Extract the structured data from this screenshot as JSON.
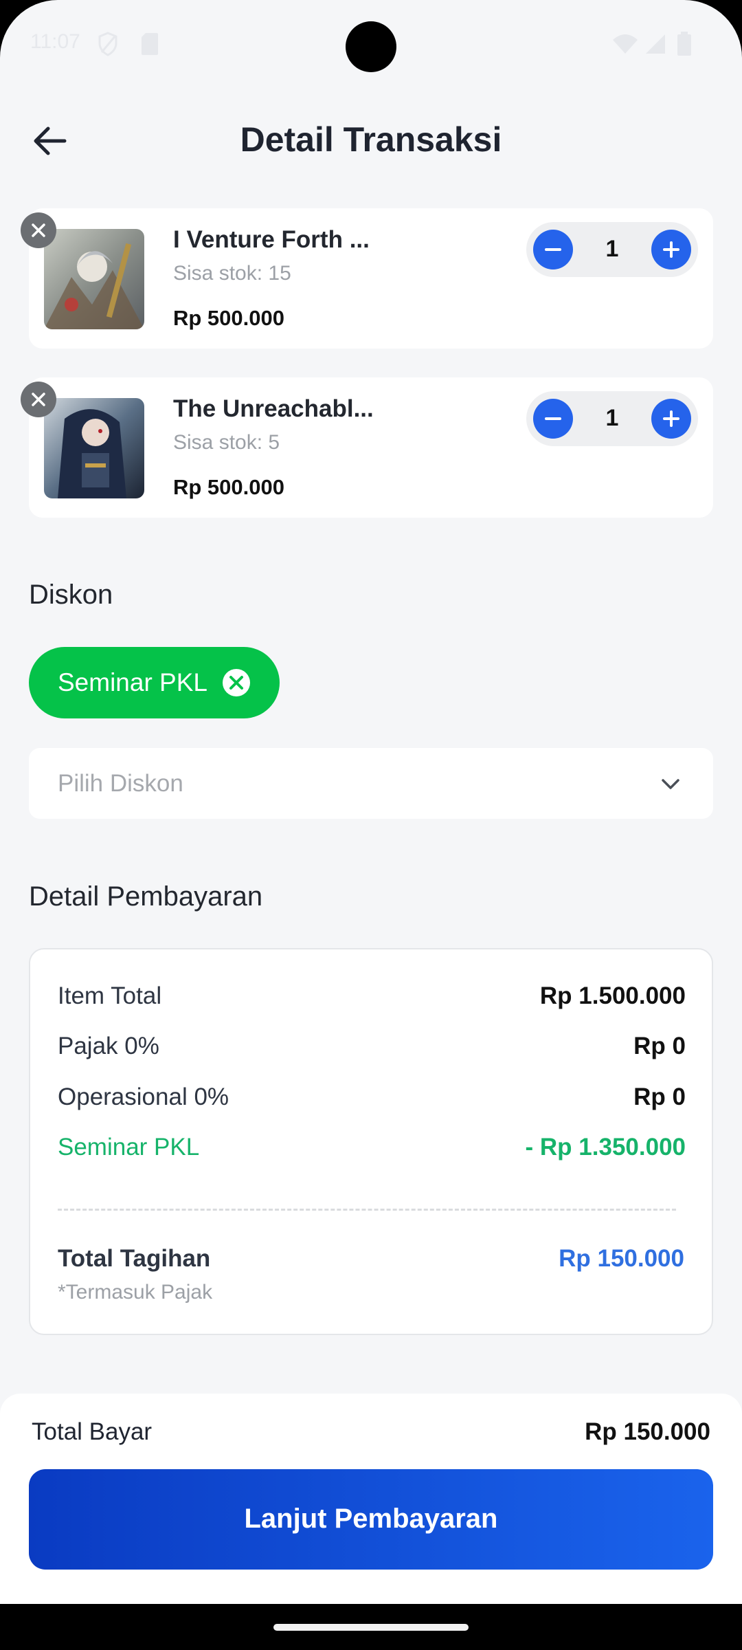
{
  "status_bar": {
    "time": "11:07"
  },
  "header": {
    "title": "Detail Transaksi"
  },
  "cart": {
    "items": [
      {
        "name": "I Venture Forth ...",
        "stock": "Sisa stok: 15",
        "price": "Rp 500.000",
        "qty": "1"
      },
      {
        "name": "The Unreachabl...",
        "stock": "Sisa stok: 5",
        "price": "Rp 500.000",
        "qty": "1"
      }
    ]
  },
  "discount": {
    "section_title": "Diskon",
    "applied_chip": "Seminar PKL",
    "select_placeholder": "Pilih Diskon"
  },
  "payment": {
    "section_title": "Detail Pembayaran",
    "rows": [
      {
        "label": "Item Total",
        "value": "Rp 1.500.000"
      },
      {
        "label": "Pajak 0%",
        "value": "Rp 0"
      },
      {
        "label": "Operasional 0%",
        "value": "Rp 0"
      },
      {
        "label": "Seminar PKL",
        "value": "- Rp 1.350.000"
      }
    ],
    "total_label": "Total Tagihan",
    "total_value": "Rp 150.000",
    "tax_note": "*Termasuk Pajak"
  },
  "bottom": {
    "label": "Total Bayar",
    "value": "Rp 150.000",
    "cta": "Lanjut Pembayaran"
  },
  "colors": {
    "primary": "#2563eb",
    "success": "#05c249",
    "discount_text": "#16b36a",
    "total_blue": "#2f6fe0"
  }
}
